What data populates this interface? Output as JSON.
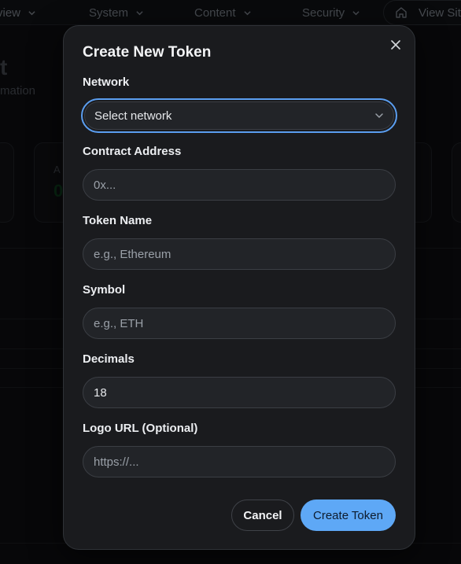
{
  "nav": {
    "items": [
      {
        "label": "view"
      },
      {
        "label": "System"
      },
      {
        "label": "Content"
      },
      {
        "label": "Security"
      }
    ],
    "view_site": "View Sit"
  },
  "background": {
    "title": "t",
    "subtitle": "mation",
    "card_label": "A",
    "card_value": "0"
  },
  "modal": {
    "title": "Create New Token",
    "close_icon": "x-icon",
    "fields": {
      "network": {
        "label": "Network",
        "value": "Select network"
      },
      "contract_address": {
        "label": "Contract Address",
        "placeholder": "0x..."
      },
      "token_name": {
        "label": "Token Name",
        "placeholder": "e.g., Ethereum"
      },
      "symbol": {
        "label": "Symbol",
        "placeholder": "e.g., ETH"
      },
      "decimals": {
        "label": "Decimals",
        "value": "18"
      },
      "logo_url": {
        "label": "Logo URL (Optional)",
        "placeholder": "https://..."
      }
    },
    "buttons": {
      "cancel": "Cancel",
      "create": "Create Token"
    }
  },
  "colors": {
    "accent": "#5ea8f6",
    "focus_ring": "#5b9ef0",
    "modal_bg": "#1a1b1e"
  }
}
